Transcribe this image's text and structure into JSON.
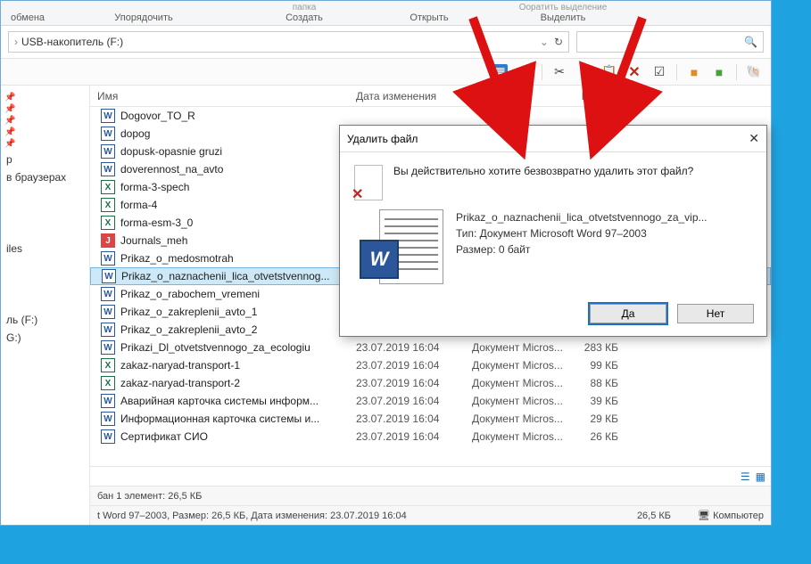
{
  "ribbon": {
    "exchange": "обмена",
    "organize": "Упорядочить",
    "folder_top": "папка",
    "create": "Создать",
    "open": "Открыть",
    "select_top": "Ооратить выделение",
    "highlight": "Выделить"
  },
  "address": {
    "path": "USB-накопитель (F:)",
    "chev": "›"
  },
  "search": {
    "placeholder": ""
  },
  "columns": {
    "name": "Имя",
    "date": "Дата изменения",
    "type": "Тип",
    "size": "Размер"
  },
  "sidebar": {
    "items": [
      {
        "label": "р"
      },
      {
        "label": "в браузерах"
      },
      {
        "label": "iles"
      },
      {
        "label": "ль (F:)"
      },
      {
        "label": "G:)"
      }
    ]
  },
  "files": [
    {
      "ico": "word",
      "name": "Dogovor_TO_R",
      "date": "",
      "type": "",
      "size": ""
    },
    {
      "ico": "word",
      "name": "dopog",
      "date": "",
      "type": "",
      "size": ""
    },
    {
      "ico": "word",
      "name": "dopusk-opasnie gruzi",
      "date": "",
      "type": "",
      "size": ""
    },
    {
      "ico": "word",
      "name": "doverennost_na_avto",
      "date": "",
      "type": "",
      "size": ""
    },
    {
      "ico": "excel",
      "name": "forma-3-spech",
      "date": "",
      "type": "",
      "size": ""
    },
    {
      "ico": "excel",
      "name": "forma-4",
      "date": "",
      "type": "",
      "size": ""
    },
    {
      "ico": "excel",
      "name": "forma-esm-3_0",
      "date": "",
      "type": "",
      "size": ""
    },
    {
      "ico": "other",
      "name": "Journals_meh",
      "date": "",
      "type": "",
      "size": ""
    },
    {
      "ico": "word",
      "name": "Prikaz_o_medosmotrah",
      "date": "",
      "type": "",
      "size": ""
    },
    {
      "ico": "word",
      "name": "Prikaz_o_naznachenii_lica_otvetstvennog...",
      "date": "",
      "type": "",
      "size": "",
      "selected": true
    },
    {
      "ico": "word",
      "name": "Prikaz_o_rabochem_vremeni",
      "date": "",
      "type": "",
      "size": ""
    },
    {
      "ico": "word",
      "name": "Prikaz_o_zakreplenii_avto_1",
      "date": "",
      "type": "",
      "size": ""
    },
    {
      "ico": "word",
      "name": "Prikaz_o_zakreplenii_avto_2",
      "date": "23.07.2019 16:03",
      "type": "Документ Micros...",
      "size": "38 КБ"
    },
    {
      "ico": "word",
      "name": "Prikazi_Dl_otvetstvennogo_za_ecologiu",
      "date": "23.07.2019 16:04",
      "type": "Документ Micros...",
      "size": "283 КБ"
    },
    {
      "ico": "excel",
      "name": "zakaz-naryad-transport-1",
      "date": "23.07.2019 16:04",
      "type": "Документ Micros...",
      "size": "99 КБ"
    },
    {
      "ico": "excel",
      "name": "zakaz-naryad-transport-2",
      "date": "23.07.2019 16:04",
      "type": "Документ Micros...",
      "size": "88 КБ"
    },
    {
      "ico": "word",
      "name": "Аварийная карточка системы информ...",
      "date": "23.07.2019 16:04",
      "type": "Документ Micros...",
      "size": "39 КБ"
    },
    {
      "ico": "word",
      "name": "Информационная карточка системы и...",
      "date": "23.07.2019 16:04",
      "type": "Документ Micros...",
      "size": "29 КБ"
    },
    {
      "ico": "word",
      "name": "Сертификат СИО",
      "date": "23.07.2019 16:04",
      "type": "Документ Micros...",
      "size": "26 КБ"
    }
  ],
  "status": {
    "left": "бан 1 элемент: 26,5 КБ",
    "bottom": "t Word 97–2003, Размер: 26,5 КБ, Дата изменения: 23.07.2019 16:04",
    "size": "26,5 КБ",
    "computer": "Компьютер"
  },
  "dialog": {
    "title": "Удалить файл",
    "question": "Вы действительно хотите безвозвратно удалить этот файл?",
    "filename": "Prikaz_o_naznachenii_lica_otvetstvennogo_za_vip...",
    "meta_type": "Тип: Документ Microsoft Word 97–2003",
    "meta_size": "Размер: 0 байт",
    "yes": "Да",
    "no": "Нет"
  }
}
